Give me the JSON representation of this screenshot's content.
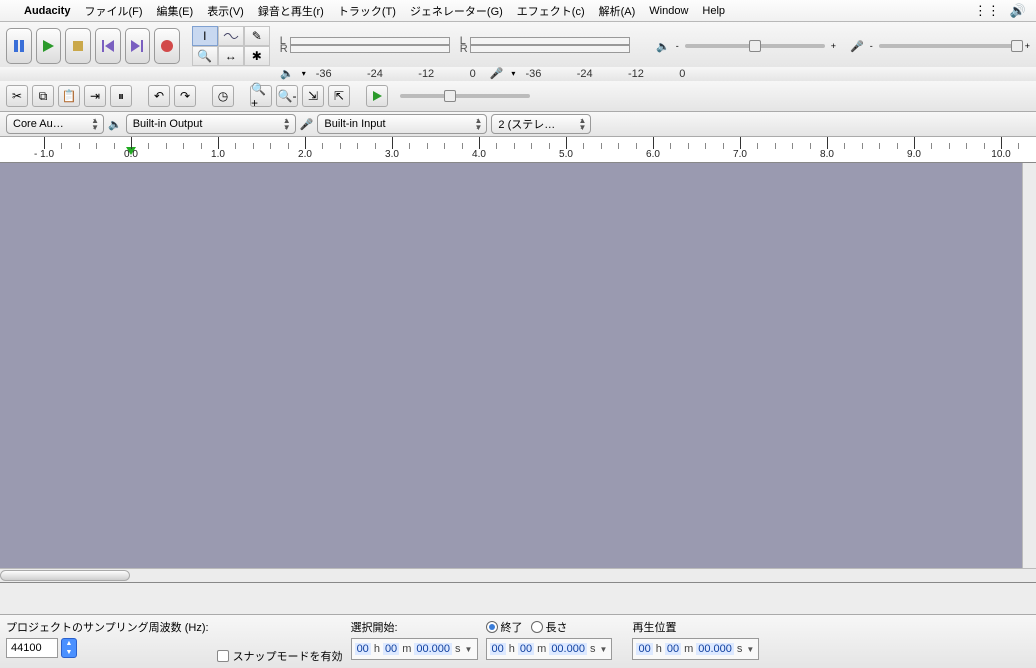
{
  "menubar": {
    "app": "Audacity",
    "items": [
      "ファイル(F)",
      "編集(E)",
      "表示(V)",
      "録音と再生(r)",
      "トラック(T)",
      "ジェネレーター(G)",
      "エフェクト(c)",
      "解析(A)",
      "Window",
      "Help"
    ]
  },
  "meter_scale": [
    "-36",
    "-24",
    "-12",
    "0"
  ],
  "devices": {
    "host": "Core Au…",
    "output": "Built-in Output",
    "input": "Built-in Input",
    "channels": "2 (ステレ…"
  },
  "ruler": {
    "labels": [
      "- 1.0",
      "0.0",
      "1.0",
      "2.0",
      "3.0",
      "4.0",
      "5.0",
      "6.0",
      "7.0",
      "8.0",
      "9.0",
      "10.0"
    ]
  },
  "status": {
    "rate_label": "プロジェクトのサンプリング周波数 (Hz):",
    "rate_value": "44100",
    "snap_label": "スナップモードを有効",
    "sel_start_label": "選択開始:",
    "end_label": "終了",
    "length_label": "長さ",
    "play_pos_label": "再生位置",
    "time": {
      "h": "00",
      "hU": "h",
      "m": "00",
      "mU": "m",
      "s": "00.000",
      "sU": "s"
    }
  }
}
